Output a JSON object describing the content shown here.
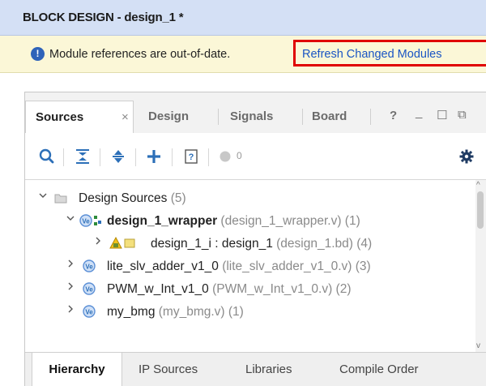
{
  "window": {
    "title": "BLOCK DESIGN - design_1 *"
  },
  "warning": {
    "message": "Module references are out-of-date.",
    "link_text": "Refresh Changed Modules",
    "icon": "info-circle-icon"
  },
  "tabs": [
    {
      "label": "Sources",
      "active": true
    },
    {
      "label": "Design",
      "active": false
    },
    {
      "label": "Signals",
      "active": false
    },
    {
      "label": "Board",
      "active": false
    }
  ],
  "tab_controls": {
    "close": "×",
    "help": "?",
    "minimize": "_",
    "maximize": "☐",
    "float": "⧉"
  },
  "toolbar": {
    "icons": [
      "search-icon",
      "collapse-all-icon",
      "expand-icon",
      "add-icon",
      "properties-icon",
      "status-dot-icon",
      "gear-icon"
    ],
    "status_count": "0"
  },
  "tree": {
    "rows": [
      {
        "label": "Design Sources",
        "extra": "(5)",
        "level": 0,
        "expanded": true,
        "icon": "folder-icon"
      },
      {
        "label": "design_1_wrapper",
        "extra": "(design_1_wrapper.v) (1)",
        "level": 1,
        "expanded": true,
        "icon": "verilog-wrapper-icon",
        "bold": true
      },
      {
        "label": "design_1_i : design_1",
        "extra": "(design_1.bd) (4)",
        "level": 2,
        "expanded": false,
        "icon": "block-design-icon"
      },
      {
        "label": "lite_slv_adder_v1_0",
        "extra": "(lite_slv_adder_v1_0.v) (3)",
        "level": 0,
        "expanded": false,
        "icon": "verilog-icon"
      },
      {
        "label": "PWM_w_Int_v1_0",
        "extra": "(PWM_w_Int_v1_0.v) (2)",
        "level": 0,
        "expanded": false,
        "icon": "verilog-icon"
      },
      {
        "label": "my_bmg",
        "extra": "(my_bmg.v) (1)",
        "level": 0,
        "expanded": false,
        "icon": "verilog-icon"
      }
    ]
  },
  "bottom_tabs": [
    {
      "label": "Hierarchy",
      "active": true
    },
    {
      "label": "IP Sources",
      "active": false
    },
    {
      "label": "Libraries",
      "active": false
    },
    {
      "label": "Compile Order",
      "active": false
    }
  ],
  "colors": {
    "title_bar": "#d4e0f5",
    "warning_bar": "#fbf7d7",
    "highlight_box": "#e00000",
    "link": "#1a55c4",
    "accent": "#2f63b9"
  }
}
